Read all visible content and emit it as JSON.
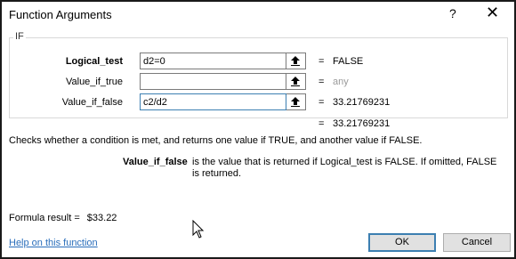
{
  "dialog": {
    "title": "Function Arguments",
    "help_glyph": "?",
    "close_glyph": "✕"
  },
  "group": {
    "label": "IF"
  },
  "args": [
    {
      "label": "Logical_test",
      "value": "d2=0",
      "result": "FALSE",
      "bold": true
    },
    {
      "label": "Value_if_true",
      "value": "",
      "result": "any",
      "bold": false
    },
    {
      "label": "Value_if_false",
      "value": "c2/d2",
      "result": "33.21769231",
      "bold": false
    }
  ],
  "overall_result": "33.21769231",
  "equals": "=",
  "function_description": "Checks whether a condition is met, and returns one value if TRUE, and another value if FALSE.",
  "argument_description": {
    "name": "Value_if_false",
    "text": "is the value that is returned if Logical_test is FALSE. If omitted, FALSE is returned."
  },
  "formula_result": {
    "label": "Formula result =",
    "value": "$33.22"
  },
  "help_link": "Help on this function",
  "buttons": {
    "ok": "OK",
    "cancel": "Cancel"
  },
  "colors": {
    "accent": "#3c7fb1",
    "link": "#2a6ebb",
    "placeholder_result": "#9a9a9a"
  }
}
